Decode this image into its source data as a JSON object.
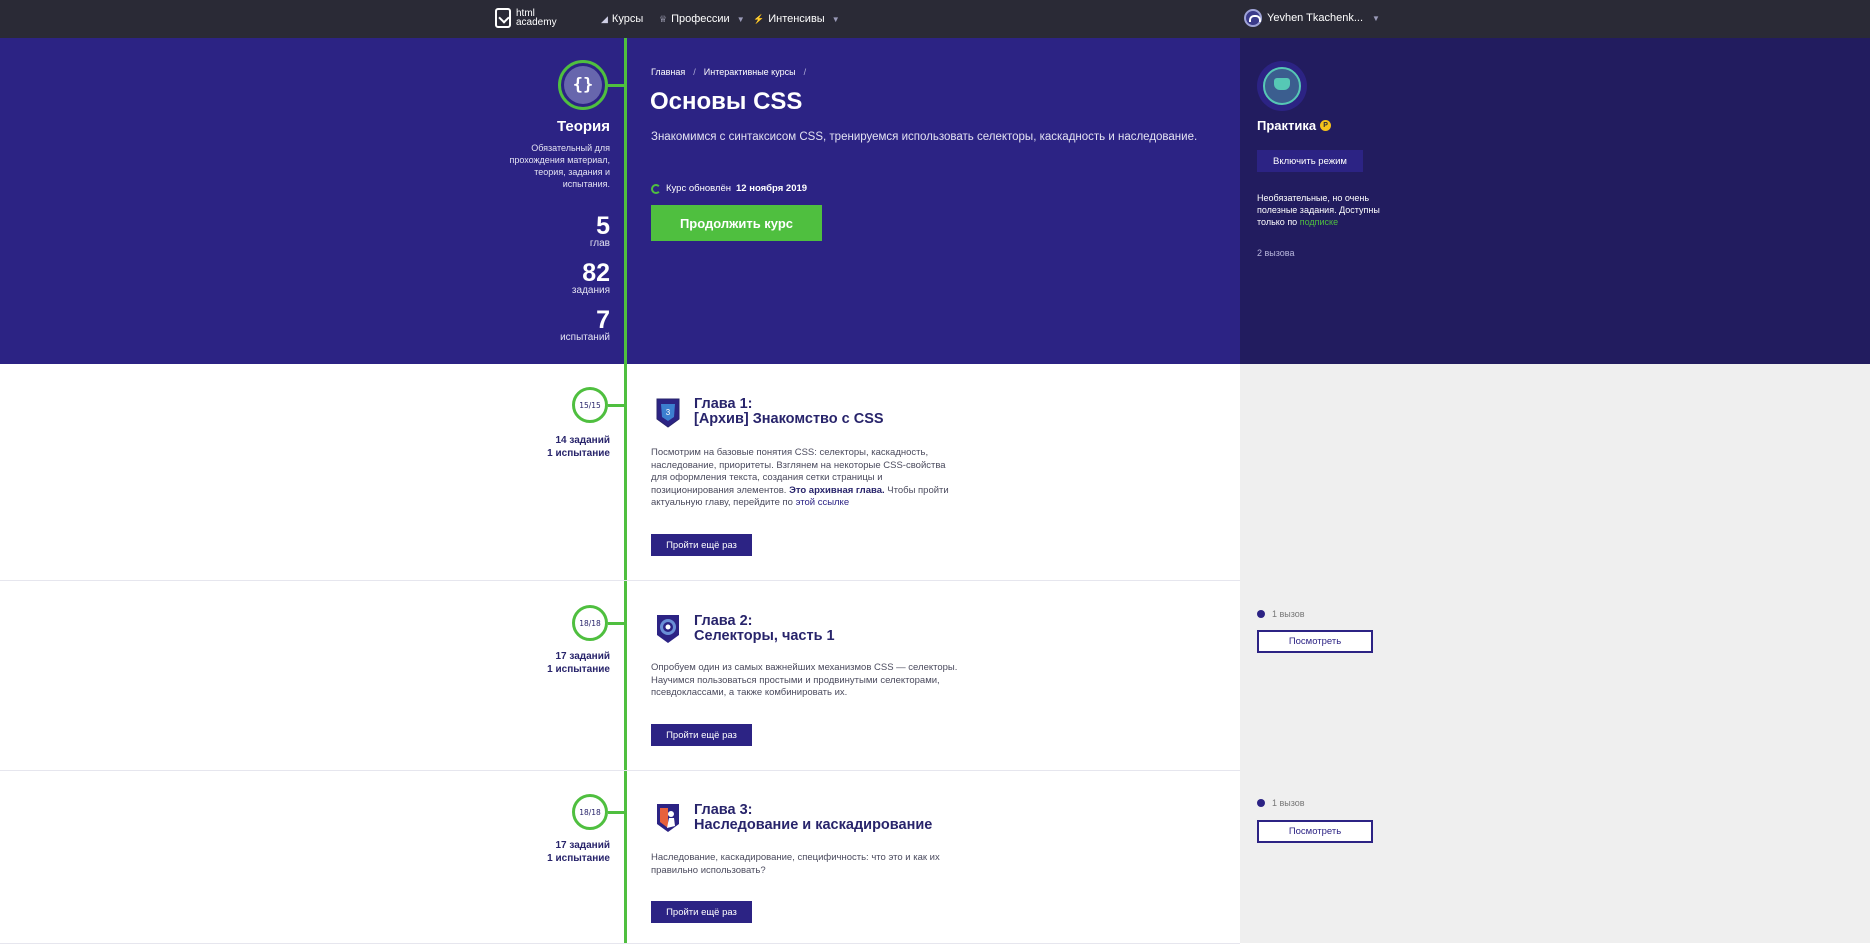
{
  "header": {
    "logo_line1": "html",
    "logo_line2": "academy",
    "nav": [
      {
        "label": "Курсы",
        "icon": "courses-icon"
      },
      {
        "label": "Профессии",
        "icon": "professions-icon"
      },
      {
        "label": "Интенсивы",
        "icon": "intensives-icon"
      }
    ],
    "user_name": "Yevhen Tkachenk..."
  },
  "theory": {
    "badge_glyph": "{}",
    "title": "Теория",
    "description": "Обязательный для прохождения материал, теория, задания и испытания.",
    "stats": [
      {
        "value": "5",
        "label": "глав"
      },
      {
        "value": "82",
        "label": "задания"
      },
      {
        "value": "7",
        "label": "испытаний"
      }
    ]
  },
  "course": {
    "breadcrumbs": [
      "Главная",
      "Интерактивные курсы"
    ],
    "breadcrumb_sep": "/",
    "title": "Основы CSS",
    "description": "Знакомимся с синтаксисом CSS, тренируемся использовать селекторы, каскадность и наследование.",
    "updated_prefix": "Курс обновлён",
    "updated_date": "12 ноября 2019",
    "continue_label": "Продолжить курс"
  },
  "practice": {
    "title": "Практика",
    "coin": "P",
    "enable_label": "Включить режим",
    "note": "Необязательные, но очень полезные задания. Доступны только по",
    "note_link": "подписке",
    "count": "2 вызова"
  },
  "chapters": [
    {
      "progress": "15/15",
      "tasks": "14 заданий",
      "tests": "1 испытание",
      "title_line1": "Глава 1:",
      "title_line2": "[Архив] Знакомство с CSS",
      "desc_part1": "Посмотрим на базовые понятия CSS: селекторы, каскадность, наследование, приоритеты. Взглянем на некоторые CSS-свойства для оформления текста, создания сетки страницы и позиционирования элементов.",
      "desc_bold": "Это архивная глава.",
      "desc_part2": "Чтобы пройти актуальную главу, перейдите по",
      "desc_link": "этой ссылке",
      "button": "Пройти ещё раз",
      "practice_count": "",
      "practice_button": ""
    },
    {
      "progress": "18/18",
      "tasks": "17 заданий",
      "tests": "1 испытание",
      "title_line1": "Глава 2:",
      "title_line2": "Селекторы, часть 1",
      "desc_part1": "Опробуем один из самых важнейших механизмов CSS — селекторы. Научимся пользоваться простыми и продвинутыми селекторами, псевдоклассами, а также комбинировать их.",
      "button": "Пройти ещё раз",
      "practice_count": "1 вызов",
      "practice_button": "Посмотреть"
    },
    {
      "progress": "18/18",
      "tasks": "17 заданий",
      "tests": "1 испытание",
      "title_line1": "Глава 3:",
      "title_line2": "Наследование и каскадирование",
      "desc_part1": "Наследование, каскадирование, специфичность: что это и как их правильно использовать?",
      "button": "Пройти ещё раз",
      "practice_count": "1 вызов",
      "practice_button": "Посмотреть"
    }
  ],
  "colors": {
    "hero": "#2c2384",
    "hero_right": "#221c5f",
    "accent_green": "#4fbf3f",
    "topbar": "#2a2a36",
    "gray_panel": "#efefef"
  }
}
